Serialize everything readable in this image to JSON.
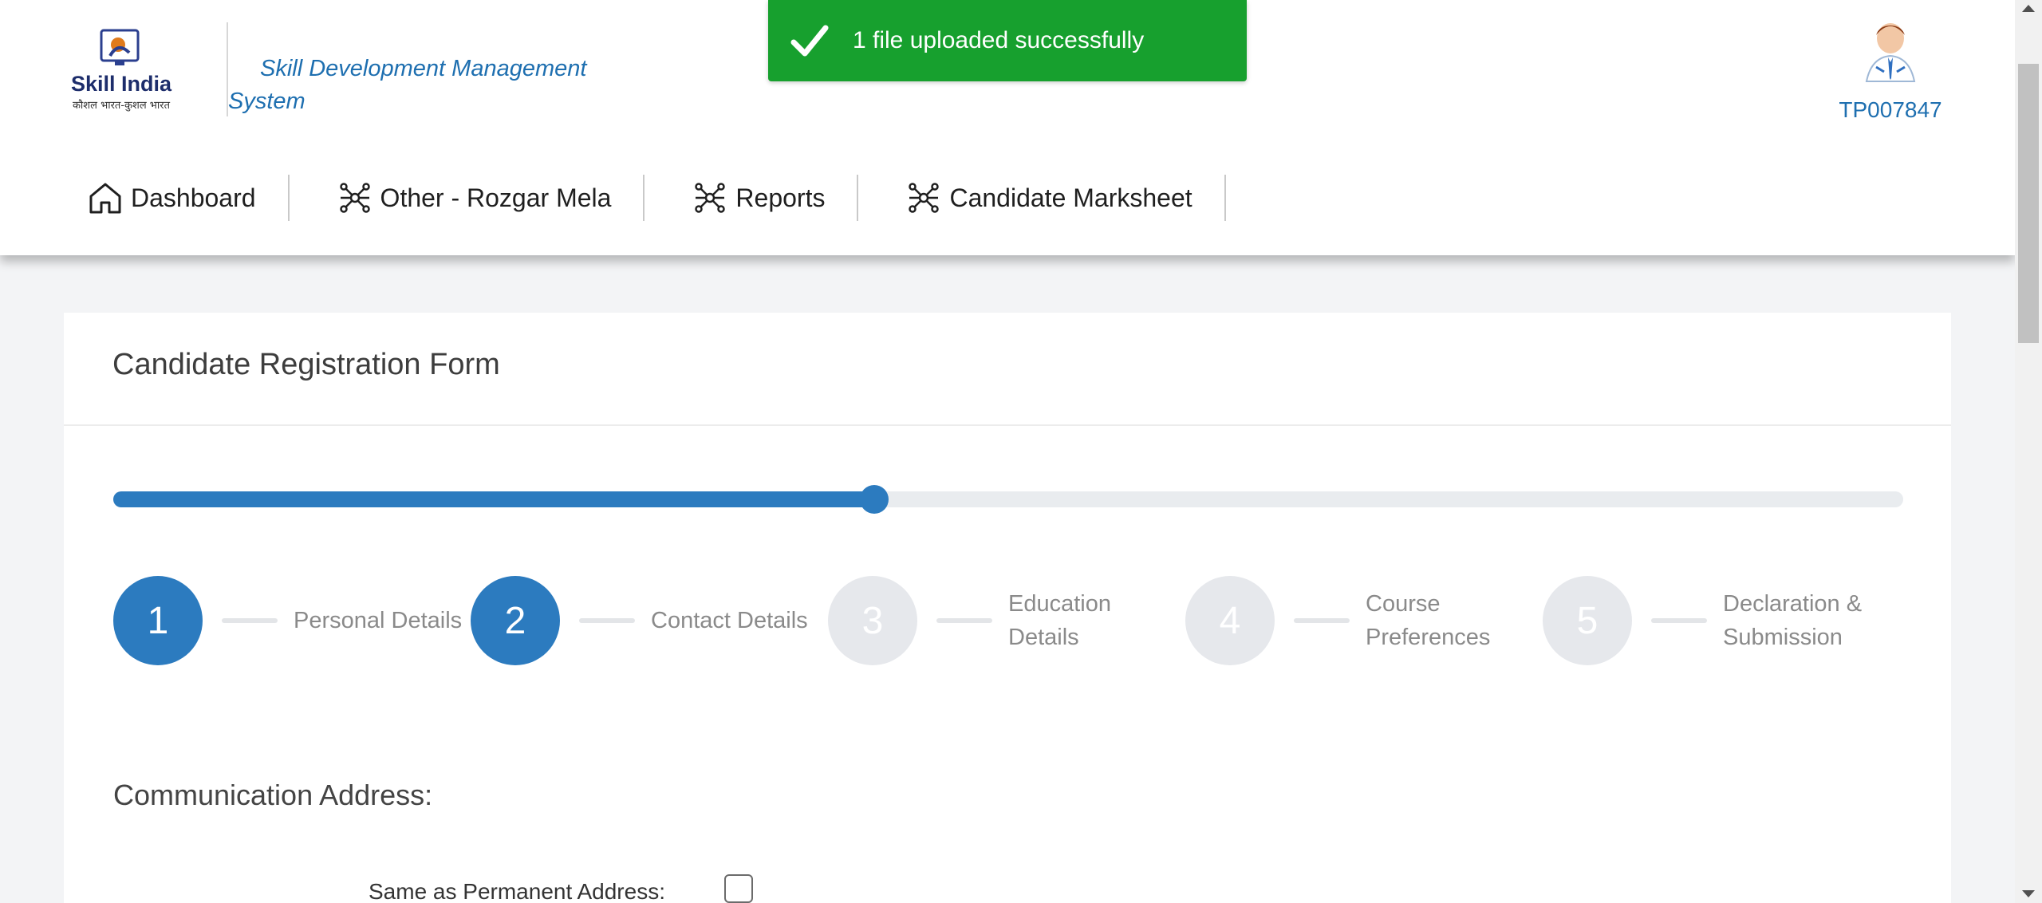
{
  "header": {
    "logo_text": "Skill India",
    "logo_subtext": "कौशल भारत-कुशल भारत",
    "system_title": "Skill Development Management System",
    "user_id": "TP007847"
  },
  "nav": {
    "items": [
      {
        "label": "Dashboard",
        "icon": "home-icon"
      },
      {
        "label": "Other - Rozgar Mela",
        "icon": "network-icon"
      },
      {
        "label": "Reports",
        "icon": "network-icon"
      },
      {
        "label": "Candidate Marksheet",
        "icon": "network-icon"
      }
    ]
  },
  "toast": {
    "message": "1 file uploaded successfully",
    "icon": "check-icon",
    "color": "#17a02e"
  },
  "form": {
    "title": "Candidate Registration Form",
    "progress_fraction": 0.425,
    "steps": [
      {
        "number": "1",
        "label": "Personal Details",
        "active": true
      },
      {
        "number": "2",
        "label": "Contact Details",
        "active": true
      },
      {
        "number": "3",
        "label": "Education Details",
        "active": false
      },
      {
        "number": "4",
        "label": "Course Preferences",
        "active": false
      },
      {
        "number": "5",
        "label": "Declaration & Submission",
        "active": false
      }
    ],
    "section_title": "Communication Address:",
    "same_as_permanent_label": "Same as Permanent Address:",
    "same_as_permanent_checked": false
  },
  "colors": {
    "accent": "#2c7bbf",
    "link": "#1e6fb0"
  }
}
